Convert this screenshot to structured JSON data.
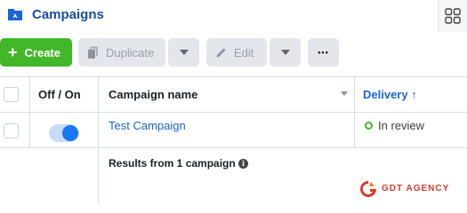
{
  "header": {
    "title": "Campaigns",
    "folder_icon": "folder-icon",
    "view_icon": "grid-view-icon"
  },
  "toolbar": {
    "create_label": "Create",
    "duplicate_label": "Duplicate",
    "edit_label": "Edit",
    "more_label": "•••"
  },
  "table": {
    "columns": [
      "Off / On",
      "Campaign name",
      "Delivery ↑"
    ],
    "rows": [
      {
        "enabled": true,
        "name": "Test Campaign",
        "delivery": "In review"
      }
    ],
    "summary": "Results from 1 campaign"
  },
  "watermark": {
    "text": "GDT AGENCY"
  },
  "colors": {
    "accent": "#1a64d6",
    "create": "#42b72a",
    "status_dot": "#42b72a",
    "watermark": "#d63a2f"
  }
}
